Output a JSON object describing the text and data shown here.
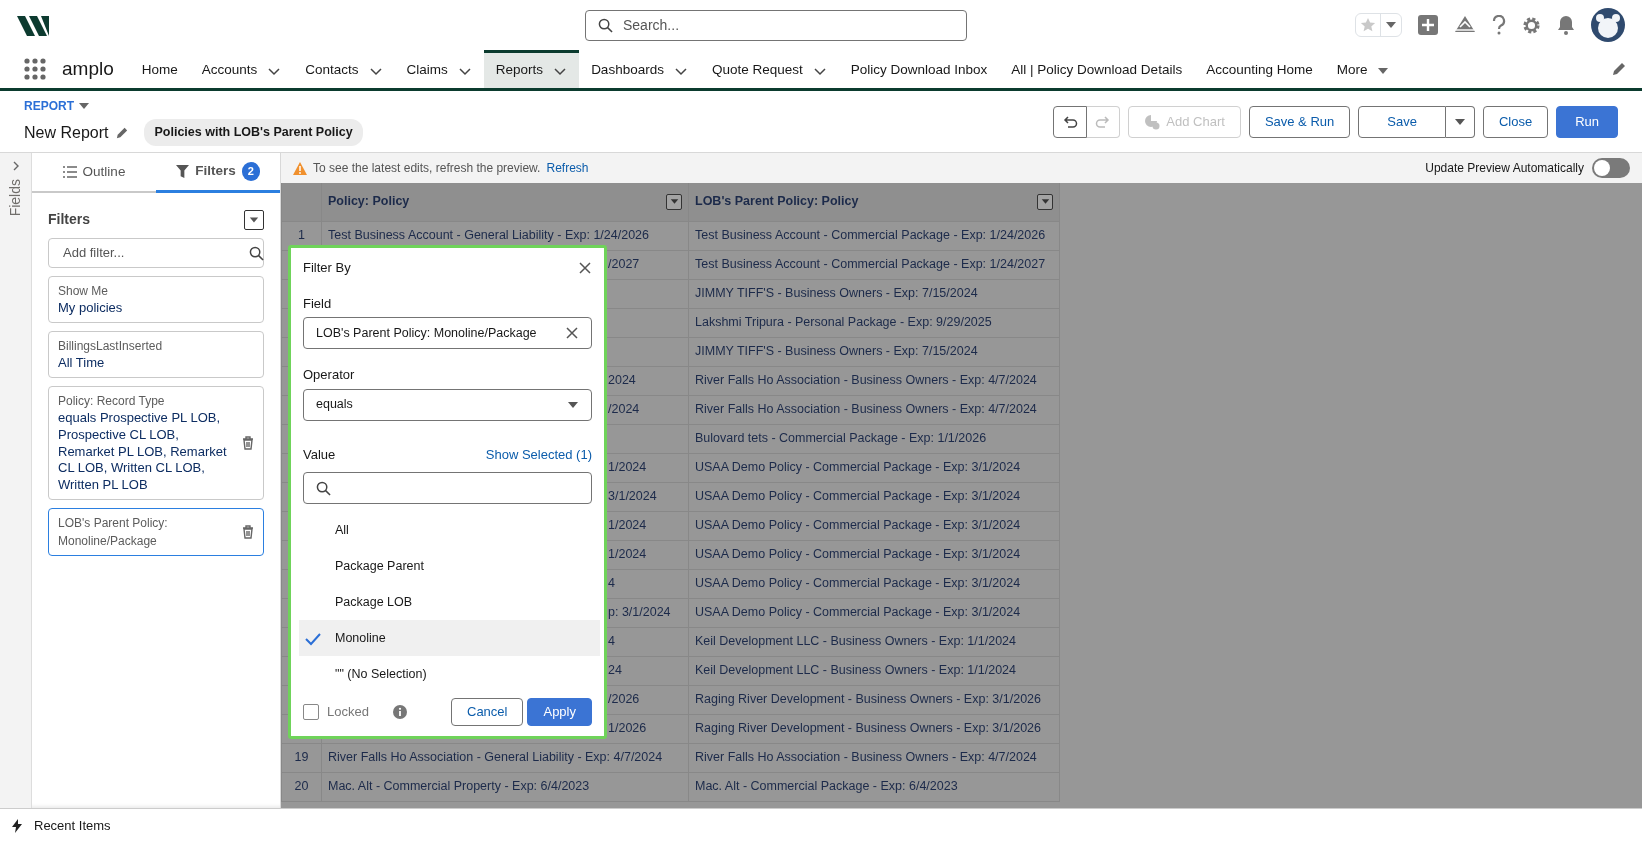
{
  "app": {
    "name": "amplo"
  },
  "search": {
    "placeholder": "Search..."
  },
  "nav": [
    {
      "label": "Home",
      "kind": "plain",
      "selected": false
    },
    {
      "label": "Accounts",
      "kind": "chevron",
      "selected": false
    },
    {
      "label": "Contacts",
      "kind": "chevron",
      "selected": false
    },
    {
      "label": "Claims",
      "kind": "chevron",
      "selected": false
    },
    {
      "label": "Reports",
      "kind": "chevron",
      "selected": true
    },
    {
      "label": "Dashboards",
      "kind": "chevron",
      "selected": false
    },
    {
      "label": "Quote Request",
      "kind": "chevron",
      "selected": false
    },
    {
      "label": "Policy Download Inbox",
      "kind": "plain",
      "selected": false
    },
    {
      "label": "All | Policy Download Details",
      "kind": "plain",
      "selected": false
    },
    {
      "label": "Accounting Home",
      "kind": "plain",
      "selected": false
    },
    {
      "label": "More",
      "kind": "more",
      "selected": false
    }
  ],
  "report": {
    "type_label": "REPORT",
    "title": "New Report",
    "report_type": "Policies with LOB's Parent Policy"
  },
  "toolbar": [
    {
      "label": "Add Chart",
      "kind": "chart",
      "disabled": true
    },
    {
      "label": "Save & Run",
      "kind": "outline",
      "disabled": false
    },
    {
      "label": "Save",
      "kind": "split",
      "disabled": false
    },
    {
      "label": "Close",
      "kind": "outline",
      "disabled": false
    },
    {
      "label": "Run",
      "kind": "primary",
      "disabled": false
    }
  ],
  "fields_tab": "Fields",
  "panel": {
    "tabs": [
      {
        "label": "Outline",
        "kind": "outline",
        "selected": false
      },
      {
        "label": "Filters",
        "kind": "filters",
        "count": "2",
        "selected": true
      }
    ],
    "heading": "Filters",
    "add_filter_placeholder": "Add filter...",
    "filters": [
      {
        "label": "Show Me",
        "value": "My policies",
        "deletable": false,
        "selected": false
      },
      {
        "label": "BillingsLastInserted",
        "value": "All Time",
        "deletable": false,
        "selected": false
      },
      {
        "label": "Policy: Record Type",
        "value": "equals Prospective PL LOB, Prospective CL LOB, Remarket PL LOB, Remarket CL LOB, Written CL LOB, Written PL LOB",
        "deletable": true,
        "selected": false
      },
      {
        "label": "LOB's Parent Policy: Monoline/Package",
        "deletable": true,
        "selected": true
      }
    ]
  },
  "notice": {
    "text": "To see the latest edits, refresh the preview.",
    "link": "Refresh"
  },
  "auto_preview": {
    "label": "Update Preview Automatically",
    "on": false
  },
  "table": {
    "columns": [
      "Policy: Policy",
      "LOB's Parent Policy: Policy"
    ],
    "rows": [
      {
        "number": "1",
        "policy": "Test Business Account - General Liability - Exp: 1/24/2026",
        "clipped": false,
        "parent": "Test Business Account - Commercial Package - Exp: 1/24/2026"
      },
      {
        "policy": "/2027",
        "clipped": true,
        "parent": "Test Business Account - Commercial Package - Exp: 1/24/2027"
      },
      {
        "parent": "JIMMY TIFF'S - Business Owners - Exp: 7/15/2024"
      },
      {
        "parent": "Lakshmi Tripura - Personal Package - Exp: 9/29/2025"
      },
      {
        "parent": "JIMMY TIFF'S - Business Owners - Exp: 7/15/2024"
      },
      {
        "policy": "2024",
        "clipped": true,
        "parent": "River Falls Ho Association - Business Owners - Exp: 4/7/2024"
      },
      {
        "policy": "/2024",
        "clipped": true,
        "parent": "River Falls Ho Association - Business Owners - Exp: 4/7/2024"
      },
      {
        "parent": "Bulovard tets - Commercial Package - Exp: 1/1/2026"
      },
      {
        "policy": "1/2024",
        "clipped": true,
        "parent": "USAA Demo Policy - Commercial Package - Exp: 3/1/2024"
      },
      {
        "policy": "3/1/2024",
        "clipped": true,
        "parent": "USAA Demo Policy - Commercial Package - Exp: 3/1/2024"
      },
      {
        "policy": "1/2024",
        "clipped": true,
        "parent": "USAA Demo Policy - Commercial Package - Exp: 3/1/2024"
      },
      {
        "policy": "1/2024",
        "clipped": true,
        "parent": "USAA Demo Policy - Commercial Package - Exp: 3/1/2024"
      },
      {
        "policy": "4",
        "clipped": true,
        "parent": "USAA Demo Policy - Commercial Package - Exp: 3/1/2024"
      },
      {
        "policy": "p: 3/1/2024",
        "clipped": true,
        "parent": "USAA Demo Policy - Commercial Package - Exp: 3/1/2024"
      },
      {
        "policy": "4",
        "clipped": true,
        "parent": "Keil Development LLC - Business Owners - Exp: 1/1/2024"
      },
      {
        "policy": "24",
        "clipped": true,
        "parent": "Keil Development LLC - Business Owners - Exp: 1/1/2024"
      },
      {
        "policy": "/2026",
        "clipped": true,
        "parent": "Raging River Development - Business Owners - Exp: 3/1/2026"
      },
      {
        "policy": "1/2026",
        "clipped": true,
        "parent": "Raging River Development - Business Owners - Exp: 3/1/2026"
      },
      {
        "number": "19",
        "policy": "River Falls Ho Association - General Liability - Exp: 4/7/2024",
        "clipped": false,
        "parent": "River Falls Ho Association - Business Owners - Exp: 4/7/2024"
      },
      {
        "number": "20",
        "policy": "Mac. Alt - Commercial Property - Exp: 6/4/2023",
        "clipped": false,
        "parent": "Mac. Alt - Commercial Package - Exp: 6/4/2023"
      }
    ]
  },
  "popup": {
    "title": "Filter By",
    "field_label": "Field",
    "field_value": "LOB's Parent Policy: Monoline/Package",
    "operator_label": "Operator",
    "operator_value": "equals",
    "value_label": "Value",
    "show_selected": "Show Selected (1)",
    "options": [
      {
        "label": "All",
        "selected": false
      },
      {
        "label": "Package Parent",
        "selected": false
      },
      {
        "label": "Package LOB",
        "selected": false
      },
      {
        "label": "Monoline",
        "selected": true
      },
      {
        "label": "\"\" (No Selection)",
        "selected": false
      }
    ],
    "locked": {
      "label": "Locked",
      "checked": false
    },
    "buttons": [
      {
        "label": "Cancel",
        "kind": "outline"
      },
      {
        "label": "Apply",
        "kind": "primary"
      }
    ]
  },
  "footer": {
    "label": "Recent Items"
  }
}
